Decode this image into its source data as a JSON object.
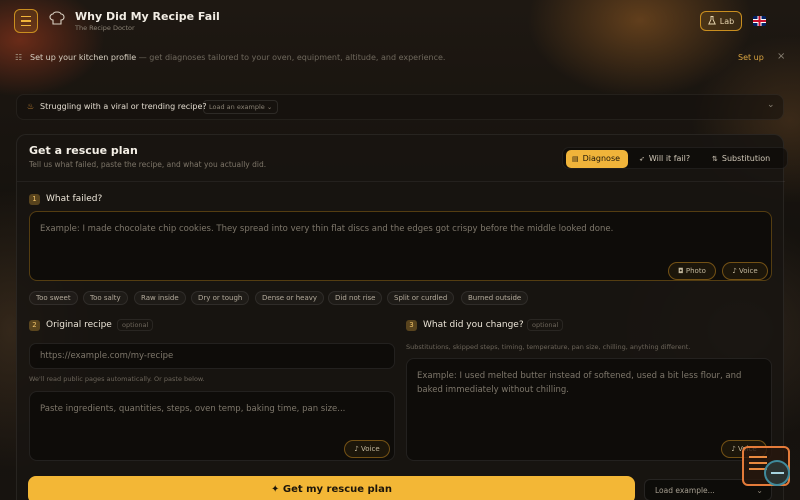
{
  "header": {
    "app_title": "Why Did My Recipe Fail",
    "app_subtitle": "The Recipe Doctor",
    "lab_label": "Lab",
    "language": "English (UK)"
  },
  "profile_bar": {
    "text": "Set up your kitchen profile",
    "muted": " — get diagnoses tailored to your oven, equipment, altitude, and experience.",
    "action": "Set up",
    "close": "×"
  },
  "viral": {
    "question": "Struggling with a viral or trending recipe?",
    "load_label": "Load an example ⌄"
  },
  "panel": {
    "title": "Get a rescue plan",
    "subtitle": "Tell us what failed, paste the recipe, and what you actually did.",
    "modes": [
      {
        "label": "Diagnose",
        "icon": "clipboard-icon"
      },
      {
        "label": "Will it fail?",
        "icon": "rocket-icon"
      },
      {
        "label": "Substitution",
        "icon": "swap-icon"
      }
    ]
  },
  "step1": {
    "num": "1",
    "label": "What failed?",
    "placeholder": "Example: I made chocolate chip cookies. They spread into very thin flat discs and the edges got crispy before the middle looked done.",
    "photo_label": "Photo",
    "voice_label": "Voice",
    "chips": [
      "Too sweet",
      "Too salty",
      "Raw inside",
      "Dry or tough",
      "Dense or heavy",
      "Did not rise",
      "Split or curdled",
      "Burned outside"
    ]
  },
  "step2": {
    "num": "2",
    "label": "Original recipe",
    "optional": "optional",
    "url_placeholder": "https://example.com/my-recipe",
    "hint": "We'll read public pages automatically. Or paste below.",
    "recipe_placeholder": "Paste ingredients, quantities, steps, oven temp, baking time, pan size...",
    "voice_label": "Voice"
  },
  "step3": {
    "num": "3",
    "label": "What did you change?",
    "optional": "optional",
    "hint": "Substitutions, skipped steps, timing, temperature, pan size, chilling, anything different.",
    "placeholder": "Example: I used melted butter instead of softened, used a bit less flour, and baked immediately without chilling.",
    "voice_label": "Voice"
  },
  "footer": {
    "cta_label": "Get my rescue plan",
    "load_example": "Load example..."
  },
  "colors": {
    "accent": "#f3b736",
    "background": "#15120e"
  }
}
